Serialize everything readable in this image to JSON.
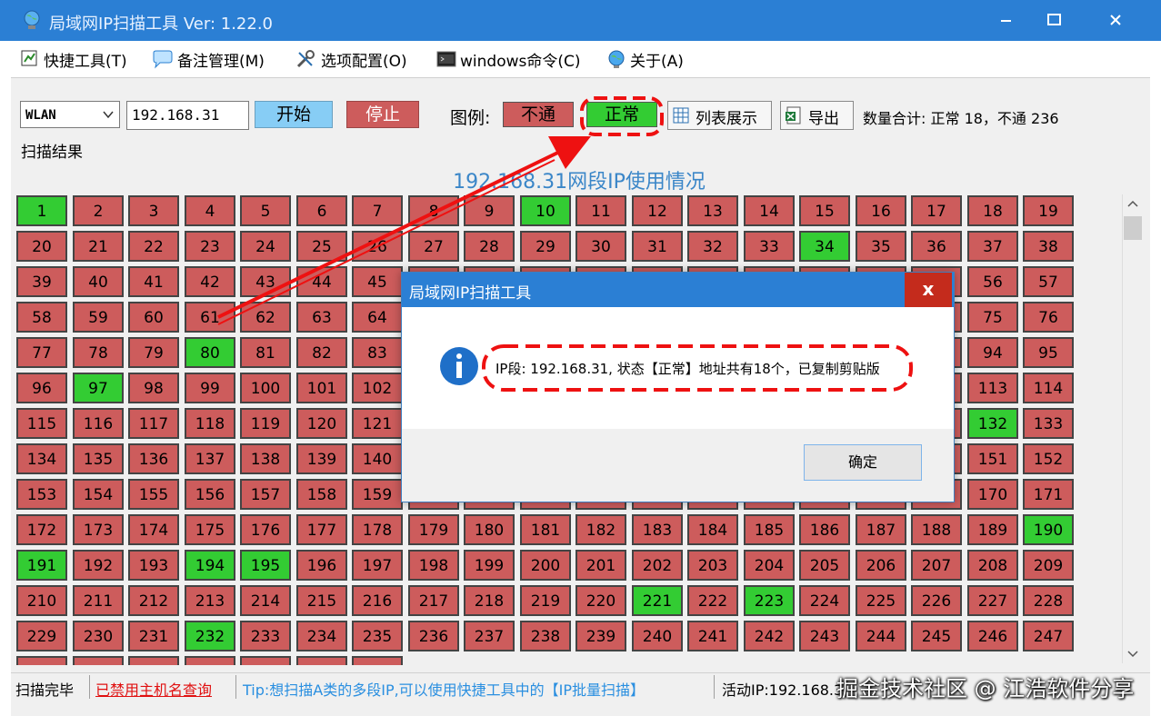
{
  "titlebar": {
    "title": "局域网IP扫描工具  Ver: 1.22.0"
  },
  "menu": [
    {
      "label": "快捷工具(T)",
      "icon": "shortcut-tools-icon"
    },
    {
      "label": "备注管理(M)",
      "icon": "speech-bubble-icon"
    },
    {
      "label": "选项配置(O)",
      "icon": "wrench-icon"
    },
    {
      "label": "windows命令(C)",
      "icon": "terminal-icon"
    },
    {
      "label": "关于(A)",
      "icon": "globe-icon"
    }
  ],
  "toolbar": {
    "adapter": "WLAN",
    "ip_prefix": "192.168.31",
    "start_label": "开始",
    "stop_label": "停止",
    "legend_label": "图例:",
    "legend_bad": "不通",
    "legend_ok": "正常",
    "list_view_label": "列表展示",
    "export_label": "导出",
    "count_text": "数量合计: 正常 18，不通 236"
  },
  "colors": {
    "ok": "#33cc33",
    "bad": "#cd5c5c",
    "title": "#3a86c8",
    "titlebar": "#2b7fd4",
    "annotation": "#ee1111"
  },
  "results": {
    "section_label": "扫描结果",
    "grid_title": "192.168.31网段IP使用情况",
    "ok_hosts": [
      1,
      10,
      34,
      80,
      97,
      132,
      190,
      191,
      194,
      195,
      221,
      223,
      232
    ]
  },
  "status": {
    "state": "扫描完毕",
    "hostname_disabled": "已禁用主机名查询",
    "tip": "Tip:想扫描A类的多段IP,可以使用快捷工具中的【IP批量扫描】",
    "active": "活动IP:192.168.3"
  },
  "watermark": "掘金技术社区 @ 江浩软件分享",
  "dialog": {
    "title": "局域网IP扫描工具",
    "close": "x",
    "message": "IP段: 192.168.31, 状态【正常】地址共有18个，已复制剪贴版",
    "ok_label": "确定"
  }
}
